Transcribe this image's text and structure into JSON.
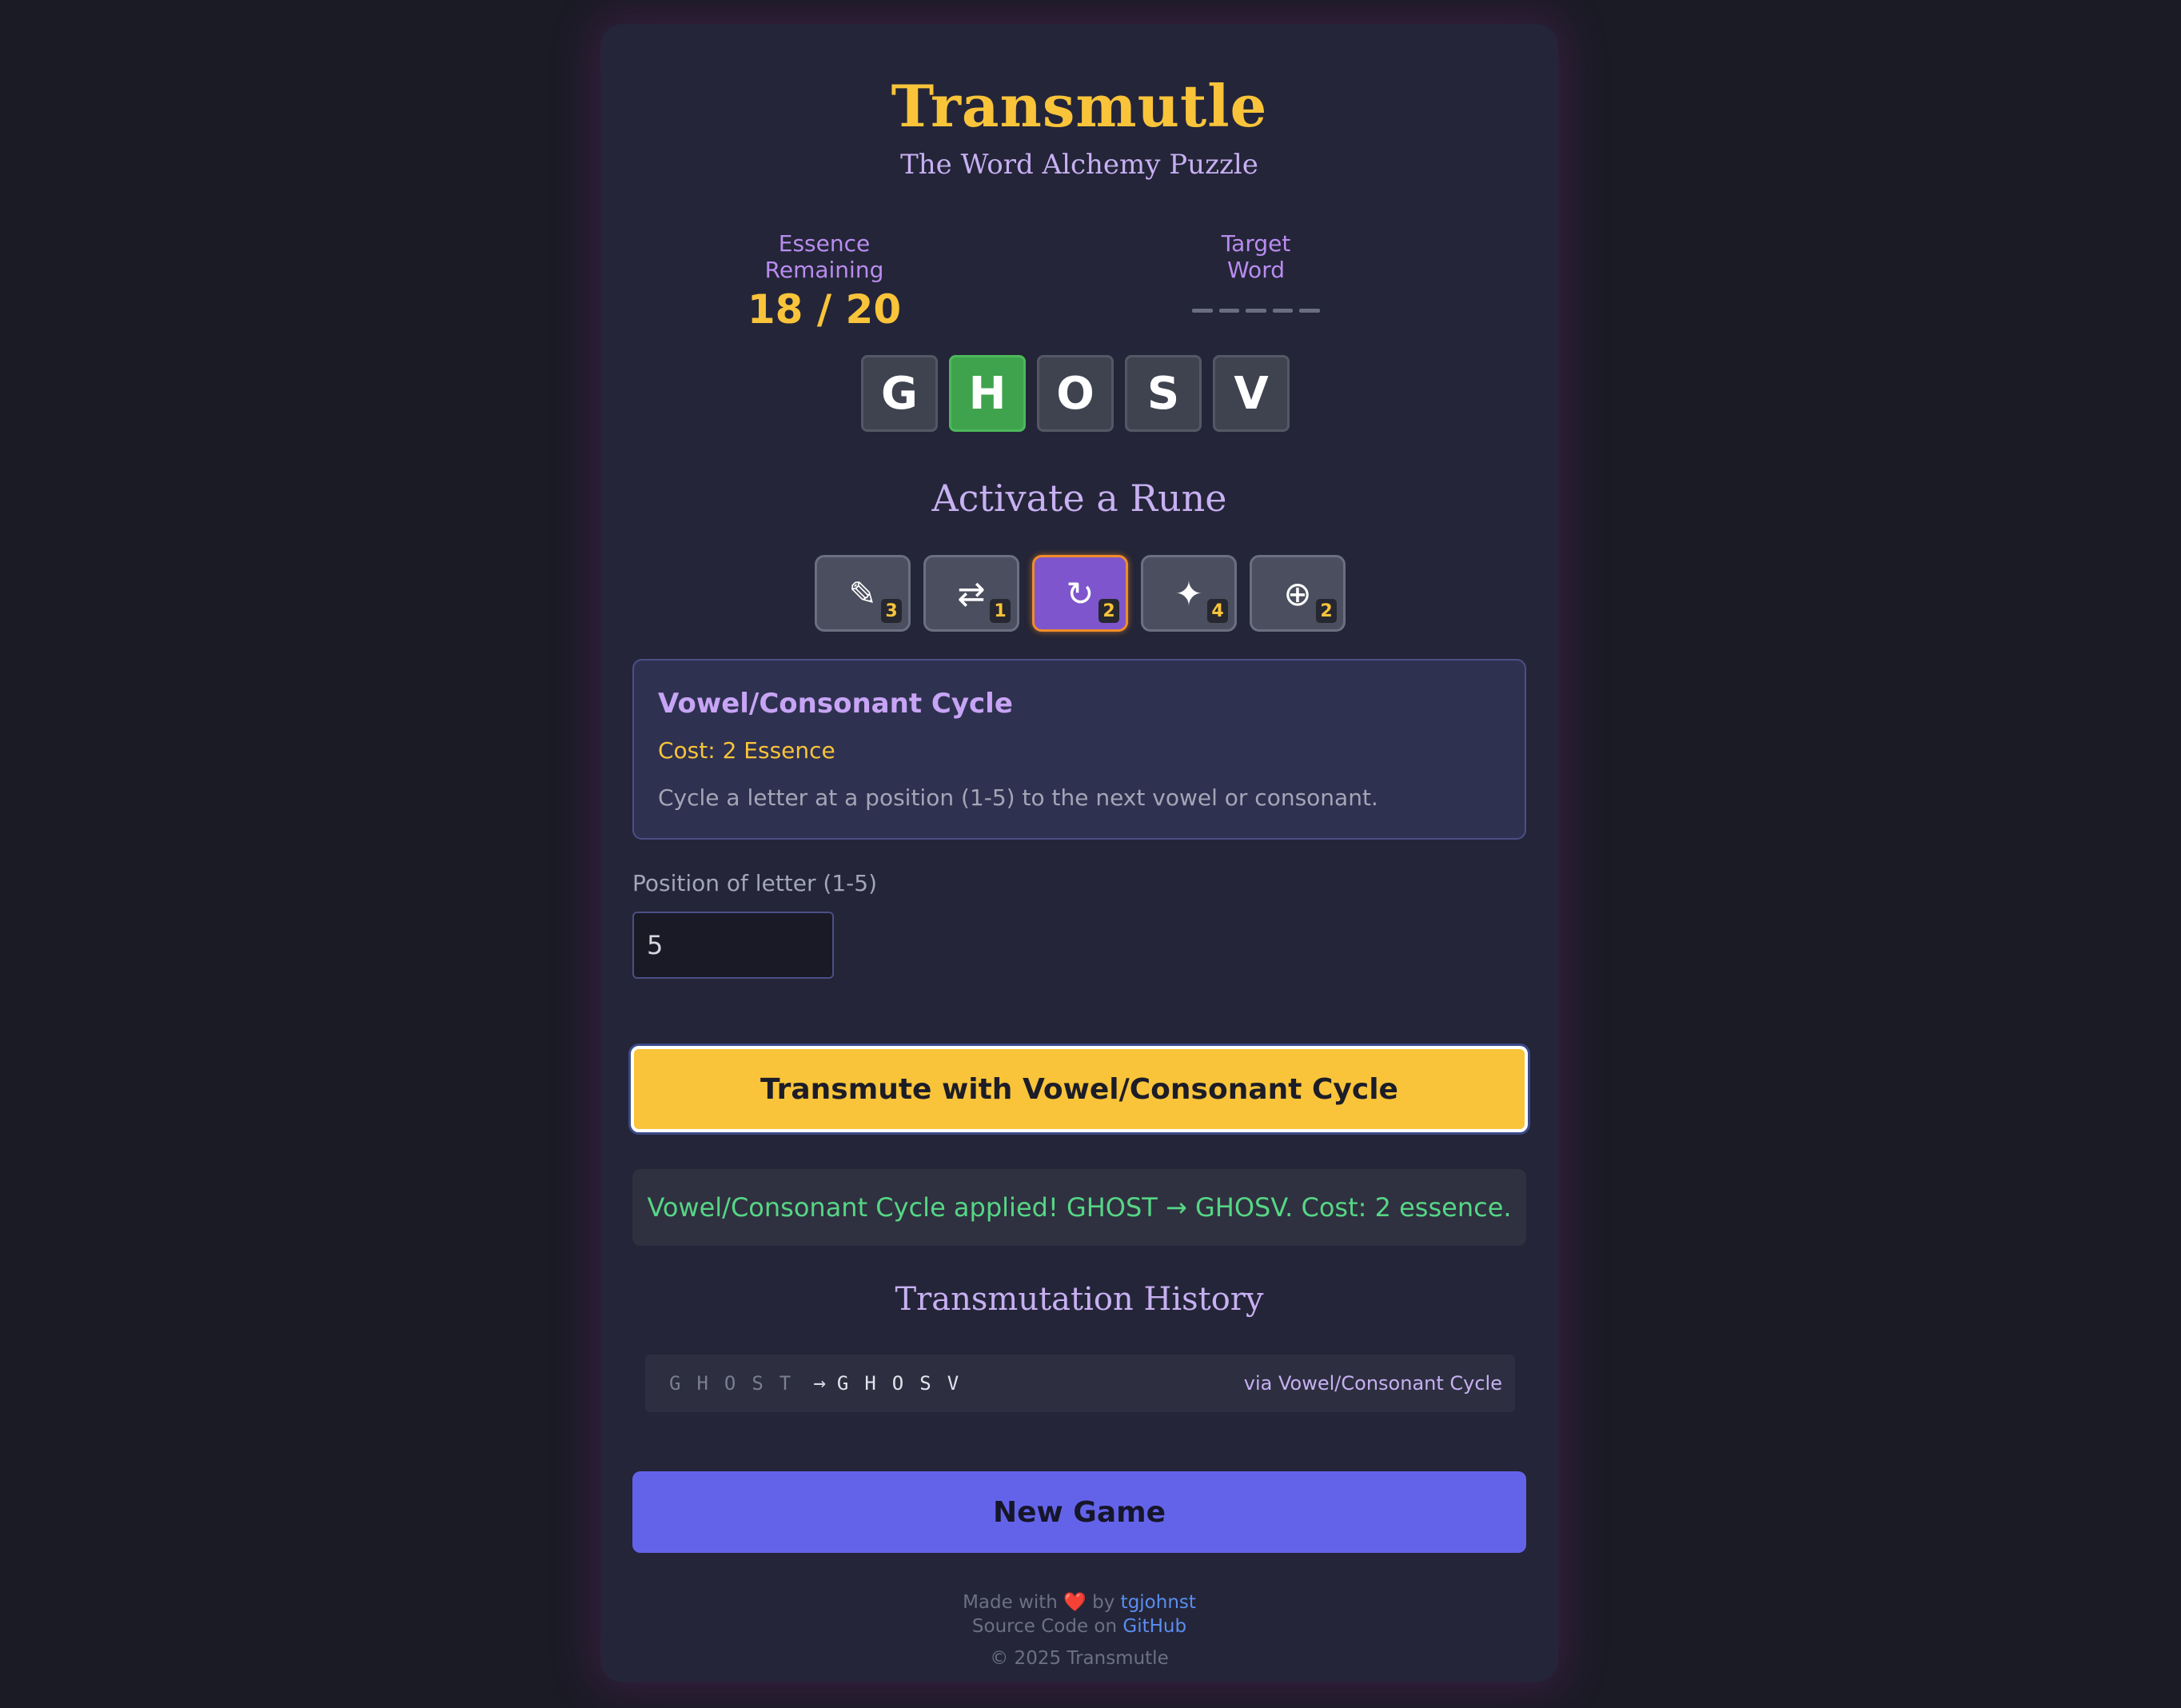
{
  "header": {
    "title": "Transmutle",
    "subtitle": "The Word Alchemy Puzzle"
  },
  "stats": {
    "essence_label": "Essence Remaining",
    "essence_value": "18 / 20",
    "target_label": "Target Word",
    "target_hidden_letters": 5
  },
  "current_word": {
    "letters": [
      "G",
      "H",
      "O",
      "S",
      "V"
    ],
    "correct_positions": [
      2
    ]
  },
  "runes": {
    "title": "Activate a Rune",
    "items": [
      {
        "icon": "pencil-icon",
        "glyph": "✎",
        "count": "3",
        "active": false
      },
      {
        "icon": "swap-arrows-icon",
        "glyph": "⇄",
        "count": "1",
        "active": false
      },
      {
        "icon": "cycle-arrow-icon",
        "glyph": "↻",
        "count": "2",
        "active": true
      },
      {
        "icon": "sparkle-icon",
        "glyph": "✦",
        "count": "4",
        "active": false
      },
      {
        "icon": "circled-plus-icon",
        "glyph": "⊕",
        "count": "2",
        "active": false
      }
    ]
  },
  "rune_info": {
    "name": "Vowel/Consonant Cycle",
    "cost": "Cost: 2 Essence",
    "description": "Cycle a letter at a position (1-5) to the next vowel or consonant."
  },
  "position_input": {
    "label": "Position of letter (1-5)",
    "value": "5"
  },
  "transmute_button": "Transmute with Vowel/Consonant Cycle",
  "message": "Vowel/Consonant Cycle applied! GHOST → GHOSV. Cost: 2 essence.",
  "history": {
    "title": "Transmutation History",
    "entries": [
      {
        "from": "GHOST",
        "arrow": "→",
        "to": "GHOSV",
        "via": "via Vowel/Consonant Cycle"
      }
    ]
  },
  "new_game_button": "New Game",
  "footer": {
    "made_with_prefix": "Made with",
    "heart": "❤️",
    "by": "by",
    "author": "tgjohnst",
    "source_prefix": "Source Code on",
    "source_link": "GitHub",
    "copyright": "© 2025 Transmutle"
  },
  "colors": {
    "accent_gold": "#f9c43a",
    "accent_purple": "#7e55cc",
    "correct_green": "#3fa34d",
    "success_text": "#56d685",
    "new_game_blue": "#6363ea"
  }
}
